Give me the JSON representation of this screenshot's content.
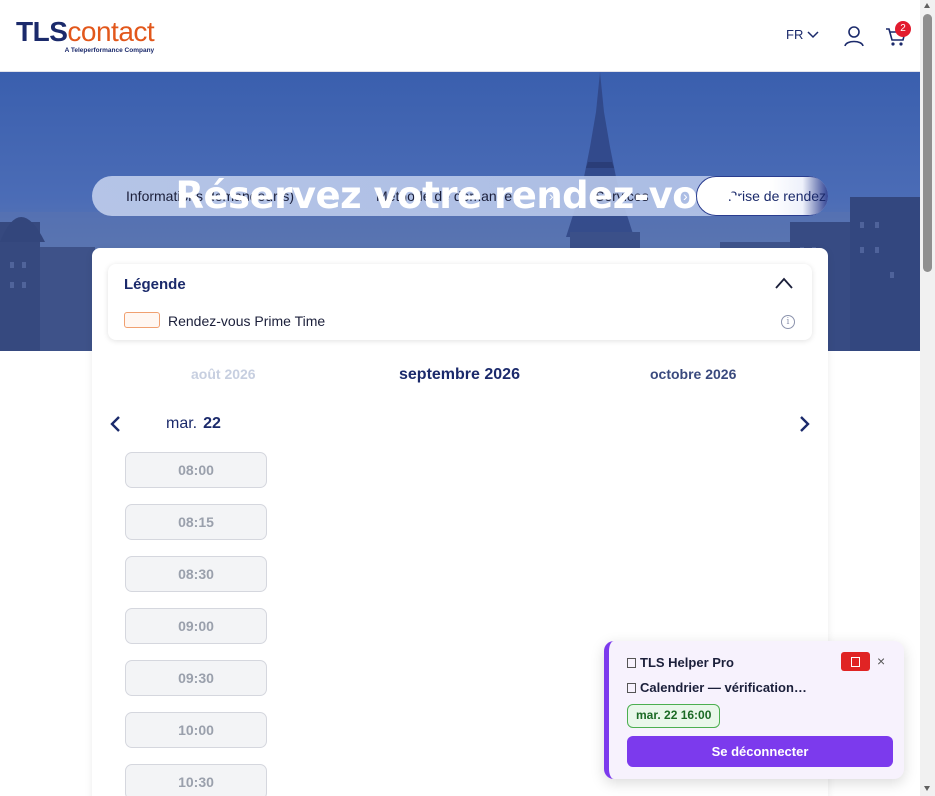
{
  "header": {
    "logo_tls": "TLS",
    "logo_contact": "contact",
    "logo_tagline": "A Teleperformance Company",
    "language": "FR",
    "cart_count": "2"
  },
  "stepper": {
    "steps": [
      "Informations demandeur(s)",
      "Méthode de demande",
      "Services",
      "Prise de rendez"
    ],
    "separator": "›"
  },
  "hero": {
    "title": "Réservez votre rendez-vous"
  },
  "legend": {
    "title": "Légende",
    "item_label": "Rendez-vous Prime Time",
    "info_glyph": "i"
  },
  "calendar": {
    "months": {
      "previous": "août 2026",
      "current": "septembre 2026",
      "next": "octobre 2026"
    },
    "day_name": "mar.",
    "day_number": "22",
    "slots": [
      "08:00",
      "08:15",
      "08:30",
      "09:00",
      "09:30",
      "10:00",
      "10:30"
    ]
  },
  "helper": {
    "title": "TLS Helper Pro",
    "status": "Calendrier — vérification…",
    "chip": "mar. 22 16:00",
    "button": "Se déconnecter",
    "close_glyph": "×"
  },
  "colors": {
    "brand_navy": "#1b2a6b",
    "brand_orange": "#e2571b",
    "helper_purple": "#7c3aed",
    "badge_red": "#e21b2e"
  },
  "icons": [
    "chevron-down-icon",
    "user-icon",
    "cart-icon",
    "chevron-up-icon",
    "info-icon",
    "chevron-left-icon",
    "chevron-right-icon",
    "close-icon"
  ]
}
